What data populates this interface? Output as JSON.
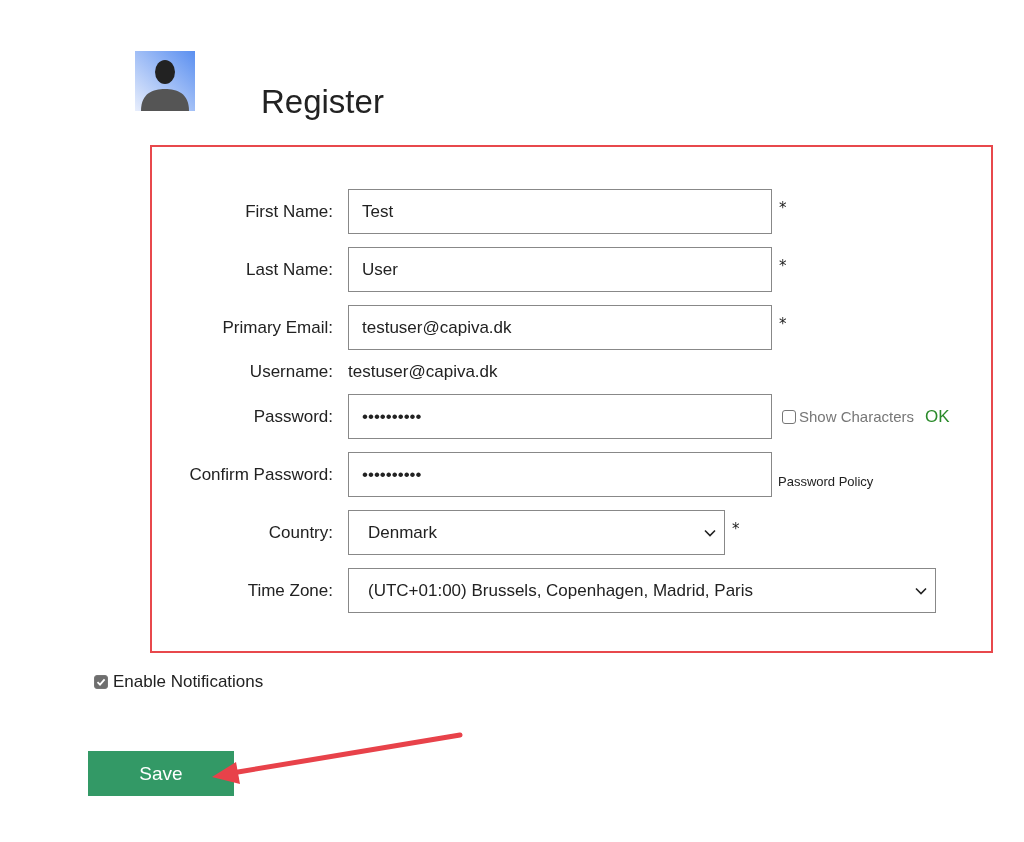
{
  "title": "Register",
  "fields": [
    {
      "kind": "input",
      "label": "First Name:",
      "value": "Test",
      "suffix": "*"
    },
    {
      "kind": "input",
      "label": "Last Name:",
      "value": "User",
      "suffix": "*"
    },
    {
      "kind": "input",
      "label": "Primary Email:",
      "value": "testuser@capiva.dk",
      "suffix": "*"
    },
    {
      "kind": "text",
      "label": "Username:",
      "value": "testuser@capiva.dk"
    },
    {
      "kind": "input",
      "label": "Password:",
      "value": "••••••••••",
      "show_characters": {
        "label": "Show Characters",
        "checked": false
      },
      "status": "OK"
    },
    {
      "kind": "input",
      "label": "Confirm Password:",
      "value": "••••••••••",
      "note": "Password Policy"
    },
    {
      "kind": "select",
      "label": "Country:",
      "value": "Denmark",
      "suffix": "*"
    },
    {
      "kind": "wide_select",
      "label": "Time Zone:",
      "value": "(UTC+01:00) Brussels, Copenhagen, Madrid, Paris"
    }
  ],
  "notifications": {
    "label": "Enable Notifications",
    "checked": true
  },
  "save_button": "Save"
}
